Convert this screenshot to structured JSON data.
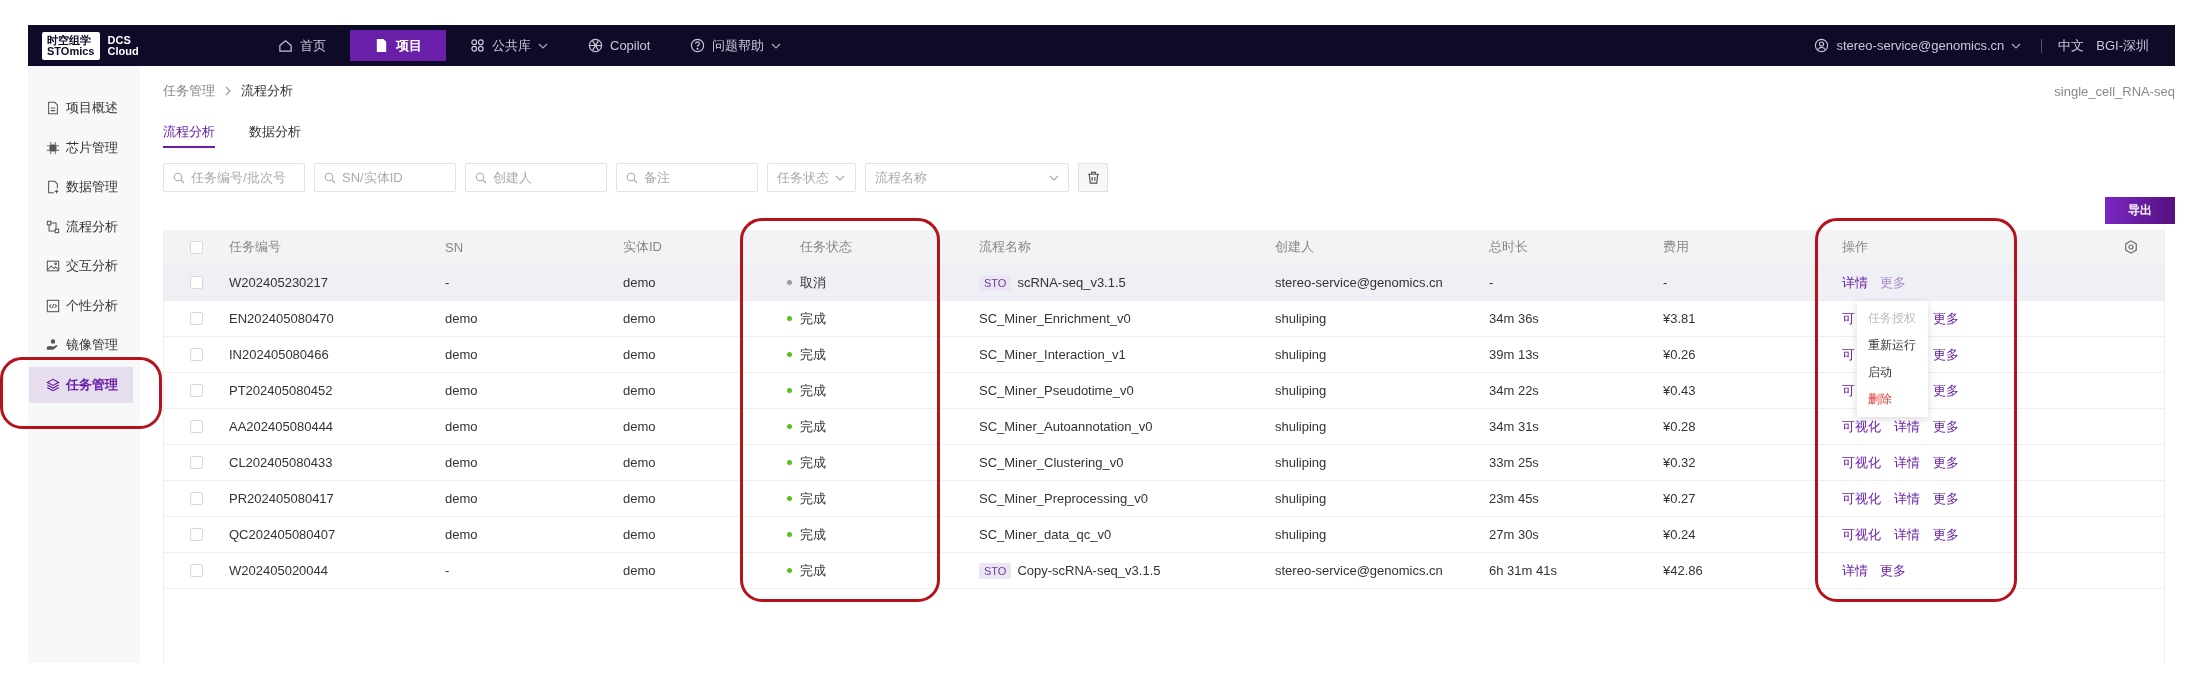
{
  "nav": {
    "logo": {
      "brand_top": "时空组学",
      "brand_bottom": "STOmics",
      "product_top": "DCS",
      "product_bottom": "Cloud"
    },
    "items": [
      {
        "label": "首页",
        "selected": false,
        "has_menu": false
      },
      {
        "label": "项目",
        "selected": true,
        "has_menu": false
      },
      {
        "label": "公共库",
        "selected": false,
        "has_menu": true
      },
      {
        "label": "Copilot",
        "selected": false,
        "has_menu": false
      },
      {
        "label": "问题帮助",
        "selected": false,
        "has_menu": true
      }
    ],
    "user": {
      "email": "stereo-service@genomics.cn"
    },
    "language": "中文",
    "site": "BGI-深圳"
  },
  "sidebar": {
    "items": [
      {
        "label": "项目概述",
        "selected": false
      },
      {
        "label": "芯片管理",
        "selected": false
      },
      {
        "label": "数据管理",
        "selected": false
      },
      {
        "label": "流程分析",
        "selected": false
      },
      {
        "label": "交互分析",
        "selected": false
      },
      {
        "label": "个性分析",
        "selected": false
      },
      {
        "label": "镜像管理",
        "selected": false
      },
      {
        "label": "任务管理",
        "selected": true
      }
    ]
  },
  "breadcrumb": [
    "任务管理",
    "流程分析"
  ],
  "project_name": "single_cell_RNA-seq",
  "tabs": [
    {
      "label": "流程分析",
      "selected": true
    },
    {
      "label": "数据分析",
      "selected": false
    }
  ],
  "filters": [
    {
      "kind": "search",
      "placeholder": "任务编号/批次号"
    },
    {
      "kind": "search",
      "placeholder": "SN/实体ID"
    },
    {
      "kind": "search",
      "placeholder": "创建人"
    },
    {
      "kind": "search",
      "placeholder": "备注"
    },
    {
      "kind": "select",
      "placeholder": "任务状态"
    },
    {
      "kind": "select",
      "placeholder": "流程名称"
    }
  ],
  "export_button": "导出",
  "table": {
    "columns": [
      "任务编号",
      "SN",
      "实体ID",
      "任务状态",
      "流程名称",
      "创建人",
      "总时长",
      "费用",
      "操作"
    ],
    "all_checked": false,
    "more_menu": [
      {
        "label": "任务授权",
        "kind": "disabled"
      },
      {
        "label": "重新运行",
        "kind": "normal"
      },
      {
        "label": "启动",
        "kind": "normal"
      },
      {
        "label": "删除",
        "kind": "danger"
      }
    ],
    "rows": [
      {
        "checked": false,
        "highlighted": true,
        "menu_open": true,
        "task_id": "W202405230217",
        "sn": "-",
        "entity_id": "demo",
        "status": {
          "label": "取消",
          "color": "#9a9aa5"
        },
        "pipeline": {
          "tag": "STO",
          "name": "scRNA-seq_v3.1.5"
        },
        "creator": "stereo-service@genomics.cn",
        "duration": "-",
        "fee": "-",
        "actions": [
          {
            "kind": "details",
            "label": "详情"
          },
          {
            "kind": "more",
            "label": "更多"
          }
        ]
      },
      {
        "checked": false,
        "highlighted": false,
        "menu_open": false,
        "task_id": "EN202405080470",
        "sn": "demo",
        "entity_id": "demo",
        "status": {
          "label": "完成",
          "color": "#52c41a"
        },
        "pipeline": {
          "name": "SC_Miner_Enrichment_v0"
        },
        "creator": "shuliping",
        "duration": "34m 36s",
        "fee": "¥3.81",
        "actions": [
          {
            "kind": "visualize",
            "label": "可"
          },
          {
            "kind": "more",
            "label": "更多"
          }
        ]
      },
      {
        "checked": false,
        "highlighted": false,
        "menu_open": false,
        "task_id": "IN202405080466",
        "sn": "demo",
        "entity_id": "demo",
        "status": {
          "label": "完成",
          "color": "#52c41a"
        },
        "pipeline": {
          "name": "SC_Miner_Interaction_v1"
        },
        "creator": "shuliping",
        "duration": "39m 13s",
        "fee": "¥0.26",
        "actions": [
          {
            "kind": "visualize",
            "label": "可"
          },
          {
            "kind": "more",
            "label": "更多"
          }
        ]
      },
      {
        "checked": false,
        "highlighted": false,
        "menu_open": false,
        "task_id": "PT202405080452",
        "sn": "demo",
        "entity_id": "demo",
        "status": {
          "label": "完成",
          "color": "#52c41a"
        },
        "pipeline": {
          "name": "SC_Miner_Pseudotime_v0"
        },
        "creator": "shuliping",
        "duration": "34m 22s",
        "fee": "¥0.43",
        "actions": [
          {
            "kind": "visualize",
            "label": "可"
          },
          {
            "kind": "more",
            "label": "更多"
          }
        ]
      },
      {
        "checked": false,
        "highlighted": false,
        "menu_open": false,
        "task_id": "AA202405080444",
        "sn": "demo",
        "entity_id": "demo",
        "status": {
          "label": "完成",
          "color": "#52c41a"
        },
        "pipeline": {
          "name": "SC_Miner_Autoannotation_v0"
        },
        "creator": "shuliping",
        "duration": "34m 31s",
        "fee": "¥0.28",
        "actions": [
          {
            "kind": "visualize",
            "label": "可视化"
          },
          {
            "kind": "details",
            "label": "详情"
          },
          {
            "kind": "more",
            "label": "更多"
          }
        ]
      },
      {
        "checked": false,
        "highlighted": false,
        "menu_open": false,
        "task_id": "CL202405080433",
        "sn": "demo",
        "entity_id": "demo",
        "status": {
          "label": "完成",
          "color": "#52c41a"
        },
        "pipeline": {
          "name": "SC_Miner_Clustering_v0"
        },
        "creator": "shuliping",
        "duration": "33m 25s",
        "fee": "¥0.32",
        "actions": [
          {
            "kind": "visualize",
            "label": "可视化"
          },
          {
            "kind": "details",
            "label": "详情"
          },
          {
            "kind": "more",
            "label": "更多"
          }
        ]
      },
      {
        "checked": false,
        "highlighted": false,
        "menu_open": false,
        "task_id": "PR202405080417",
        "sn": "demo",
        "entity_id": "demo",
        "status": {
          "label": "完成",
          "color": "#52c41a"
        },
        "pipeline": {
          "name": "SC_Miner_Preprocessing_v0"
        },
        "creator": "shuliping",
        "duration": "23m 45s",
        "fee": "¥0.27",
        "actions": [
          {
            "kind": "visualize",
            "label": "可视化"
          },
          {
            "kind": "details",
            "label": "详情"
          },
          {
            "kind": "more",
            "label": "更多"
          }
        ]
      },
      {
        "checked": false,
        "highlighted": false,
        "menu_open": false,
        "task_id": "QC202405080407",
        "sn": "demo",
        "entity_id": "demo",
        "status": {
          "label": "完成",
          "color": "#52c41a"
        },
        "pipeline": {
          "name": "SC_Miner_data_qc_v0"
        },
        "creator": "shuliping",
        "duration": "27m 30s",
        "fee": "¥0.24",
        "actions": [
          {
            "kind": "visualize",
            "label": "可视化"
          },
          {
            "kind": "details",
            "label": "详情"
          },
          {
            "kind": "more",
            "label": "更多"
          }
        ]
      },
      {
        "checked": false,
        "highlighted": false,
        "menu_open": false,
        "task_id": "W202405020044",
        "sn": "-",
        "entity_id": "demo",
        "status": {
          "label": "完成",
          "color": "#52c41a"
        },
        "pipeline": {
          "tag": "STO",
          "name": "Copy-scRNA-seq_v3.1.5"
        },
        "creator": "stereo-service@genomics.cn",
        "duration": "6h 31m 41s",
        "fee": "¥42.86",
        "actions": [
          {
            "kind": "details",
            "label": "详情"
          },
          {
            "kind": "more",
            "label": "更多"
          }
        ]
      }
    ]
  },
  "highlights": [
    {
      "kind": "sidebar_item"
    },
    {
      "kind": "status_column"
    },
    {
      "kind": "actions_column"
    }
  ]
}
